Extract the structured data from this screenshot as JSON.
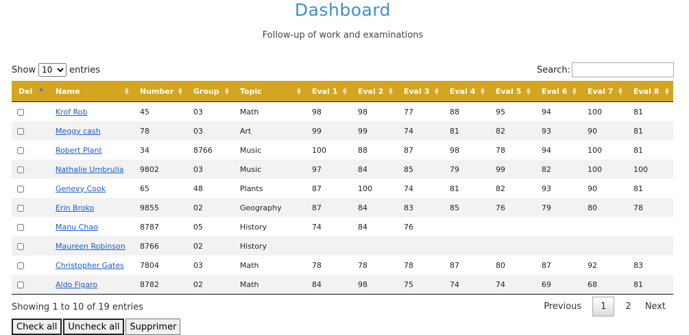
{
  "header": {
    "title": "Dashboard",
    "subtitle": "Follow-up of work and examinations"
  },
  "length": {
    "show_label": "Show",
    "selected": "10",
    "entries_label": "entries"
  },
  "search": {
    "label": "Search:",
    "value": ""
  },
  "table": {
    "columns": [
      "Del",
      "Name",
      "Number",
      "Group",
      "Topic",
      "Eval 1",
      "Eval 2",
      "Eval 3",
      "Eval 4",
      "Eval 5",
      "Eval 6",
      "Eval 7",
      "Eval 8"
    ],
    "rows": [
      {
        "name": "Krof Rob",
        "number": "45",
        "group": "03",
        "topic": "Math",
        "evals": [
          "98",
          "98",
          "77",
          "88",
          "95",
          "94",
          "100",
          "81"
        ]
      },
      {
        "name": "Meggy cash",
        "number": "78",
        "group": "03",
        "topic": "Art",
        "evals": [
          "99",
          "99",
          "74",
          "81",
          "82",
          "93",
          "90",
          "81"
        ]
      },
      {
        "name": "Robert Plant",
        "number": "34",
        "group": "8766",
        "topic": "Music",
        "evals": [
          "100",
          "88",
          "87",
          "98",
          "78",
          "94",
          "100",
          "81"
        ]
      },
      {
        "name": "Nathalie Umbrulia",
        "number": "9802",
        "group": "03",
        "topic": "Music",
        "evals": [
          "97",
          "84",
          "85",
          "79",
          "99",
          "82",
          "100",
          "100"
        ]
      },
      {
        "name": "Genevy Cook",
        "number": "65",
        "group": "48",
        "topic": "Plants",
        "evals": [
          "87",
          "100",
          "74",
          "81",
          "82",
          "93",
          "90",
          "81"
        ]
      },
      {
        "name": "Erin Broko",
        "number": "9855",
        "group": "02",
        "topic": "Geography",
        "evals": [
          "87",
          "84",
          "83",
          "85",
          "76",
          "79",
          "80",
          "78"
        ]
      },
      {
        "name": "Manu Chao",
        "number": "8787",
        "group": "05",
        "topic": "History",
        "evals": [
          "74",
          "84",
          "76",
          "",
          "",
          "",
          "",
          ""
        ]
      },
      {
        "name": "Maureen Robinson",
        "number": "8766",
        "group": "02",
        "topic": "History",
        "evals": [
          "",
          "",
          "",
          "",
          "",
          "",
          "",
          ""
        ]
      },
      {
        "name": "Christopher Gates",
        "number": "7804",
        "group": "03",
        "topic": "Math",
        "evals": [
          "78",
          "78",
          "78",
          "87",
          "80",
          "87",
          "92",
          "83"
        ]
      },
      {
        "name": "Aldo Figaro",
        "number": "8782",
        "group": "02",
        "topic": "Math",
        "evals": [
          "84",
          "98",
          "75",
          "74",
          "74",
          "69",
          "68",
          "81"
        ]
      }
    ]
  },
  "footer": {
    "info": "Showing 1 to 10 of 19 entries",
    "previous": "Previous",
    "pages": [
      "1",
      "2"
    ],
    "next": "Next"
  },
  "actions": {
    "check_all": "Check all",
    "uncheck_all": "Uncheck all",
    "delete": "Supprimer"
  }
}
